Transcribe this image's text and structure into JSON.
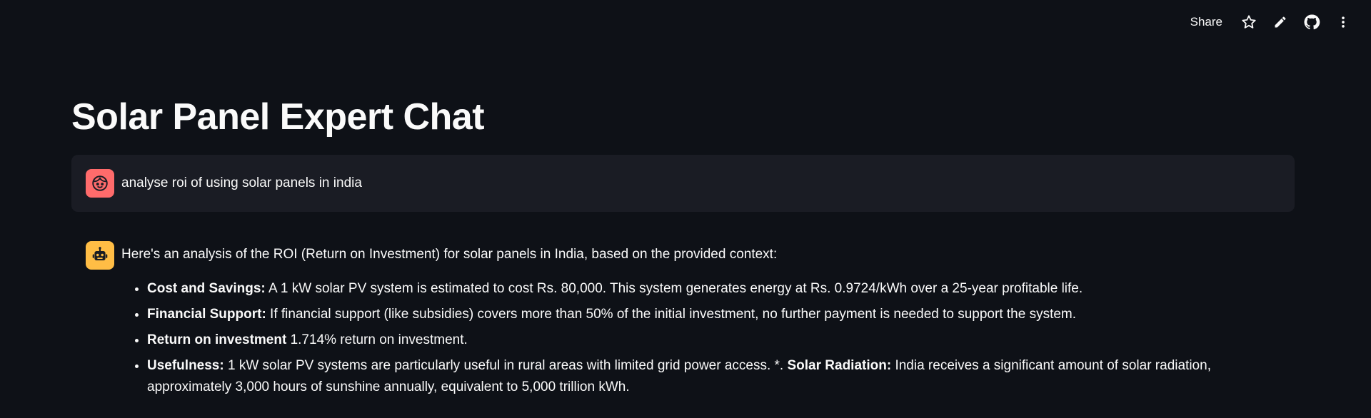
{
  "toolbar": {
    "share_label": "Share",
    "icons": [
      "star-icon",
      "pencil-icon",
      "github-icon",
      "more-vertical-icon"
    ]
  },
  "page": {
    "title": "Solar Panel Expert Chat"
  },
  "chat": {
    "user_message": {
      "avatar": "user-face-icon",
      "text": "analyse roi of using solar panels in india"
    },
    "assistant_message": {
      "avatar": "robot-icon",
      "intro": "Here's an analysis of the ROI (Return on Investment) for solar panels in India, based on the provided context:",
      "items": [
        {
          "label": "Cost and Savings:",
          "text": " A 1 kW solar PV system is estimated to cost Rs. 80,000. This system generates energy at Rs. 0.9724/kWh over a 25-year profitable life."
        },
        {
          "label": "Financial Support:",
          "text": " If financial support (like subsidies) covers more than 50% of the initial investment, no further payment is needed to support the system."
        },
        {
          "label": "Return on investment",
          "text": " 1.714% return on investment."
        },
        {
          "label": "Usefulness:",
          "text": " 1 kW solar PV systems are particularly useful in rural areas with limited grid power access. *. ",
          "label2": "Solar Radiation:",
          "text2": " India receives a significant amount of solar radiation, approximately 3,000 hours of sunshine annually, equivalent to 5,000 trillion kWh."
        }
      ]
    }
  },
  "colors": {
    "background": "#0e1117",
    "user_bubble": "#1a1c24",
    "user_avatar": "#ff6b6b",
    "bot_avatar": "#ffbd45",
    "text": "#fafafa"
  }
}
